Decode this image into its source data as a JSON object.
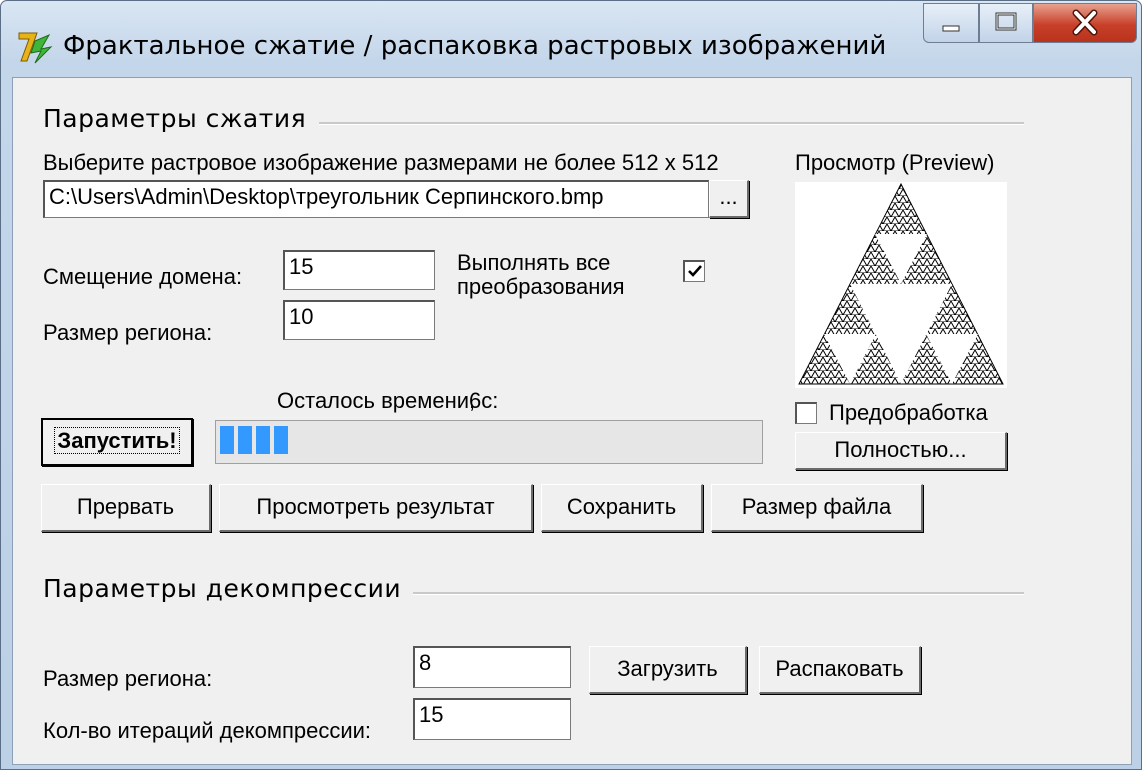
{
  "window": {
    "title": "Фрактальное сжатие / распаковка растровых изображений",
    "minimize_icon": "minimize-icon",
    "maximize_icon": "maximize-icon",
    "close_icon": "close-icon",
    "close_color": "#c8402a"
  },
  "compression": {
    "group_label": "Параметры сжатия",
    "select_label": "Выберите растровое изображение размерами не более 512 х 512",
    "file_path": "C:\\Users\\Admin\\Desktop\\треугольник Серпинского.bmp",
    "browse_label": "...",
    "domain_offset_label": "Смещение домена:",
    "domain_offset_value": "15",
    "region_size_label": "Размер региона:",
    "region_size_value": "10",
    "all_transforms_label_1": "Выполнять все",
    "all_transforms_label_2": "преобразования",
    "all_transforms_checked": true,
    "preview_label": "Просмотр (Preview)",
    "preprocess_label": "Предобработка",
    "preprocess_checked": false,
    "full_button": "Полностью...",
    "start_button": "Запустить!",
    "time_left_label": "Осталось времени, с:",
    "time_left_value": "6",
    "progress_fraction": 0.15,
    "progress_color": "#3399ff",
    "abort_button": "Прервать",
    "view_result_button": "Просмотреть результат",
    "save_button": "Сохранить",
    "file_size_button": "Размер файла"
  },
  "decompression": {
    "group_label": "Параметры декомпрессии",
    "region_size_label": "Размер региона:",
    "region_size_value": "8",
    "iterations_label": "Кол-во итераций декомпрессии:",
    "iterations_value": "15",
    "load_button": "Загрузить",
    "unpack_button": "Распаковать"
  }
}
